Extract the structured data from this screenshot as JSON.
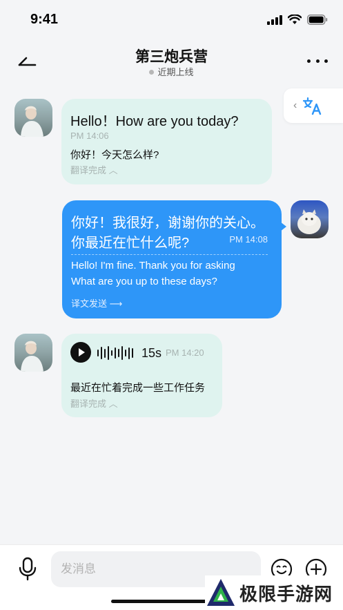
{
  "status_bar": {
    "time": "9:41"
  },
  "header": {
    "title": "第三炮兵营",
    "online_status": "近期上线"
  },
  "messages": [
    {
      "direction": "incoming",
      "text": "Hello！How are you today?",
      "time": "PM 14:06",
      "translation": "你好！今天怎么样?",
      "status": "翻译完成"
    },
    {
      "direction": "outgoing",
      "text_line1": "你好！我很好，谢谢你的关心。",
      "text_line2": "你最近在忙什么呢?",
      "time": "PM 14:08",
      "translation_line1": "Hello! I'm fine. Thank you for asking",
      "translation_line2": "What are you up to these days?",
      "status": "译文发送"
    },
    {
      "direction": "incoming",
      "type": "voice",
      "duration": "15s",
      "time": "PM 14:20",
      "translation": "最近在忙着完成一些工作任务",
      "status": "翻译完成"
    }
  ],
  "input": {
    "placeholder": "发消息"
  },
  "watermark": {
    "text": "极限手游网"
  },
  "colors": {
    "incoming_bubble": "#dff3ef",
    "outgoing_bubble": "#2e96f8",
    "accent": "#2e96f8"
  }
}
